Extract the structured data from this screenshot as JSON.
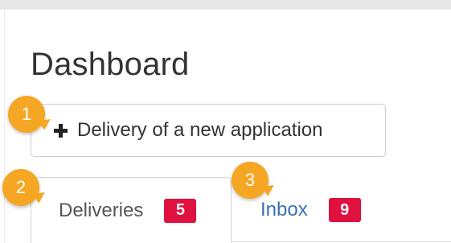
{
  "page": {
    "title": "Dashboard"
  },
  "actions": {
    "new_application_label": "Delivery of a new application",
    "new_application_icon": "plus-icon"
  },
  "tabs": [
    {
      "label": "Deliveries",
      "count": "5",
      "active": true
    },
    {
      "label": "Inbox",
      "count": "9",
      "active": false
    }
  ],
  "markers": [
    {
      "number": "1"
    },
    {
      "number": "2"
    },
    {
      "number": "3"
    }
  ],
  "colors": {
    "badge": "#e0103f",
    "marker": "#f5a623",
    "link": "#3b6fb6"
  }
}
